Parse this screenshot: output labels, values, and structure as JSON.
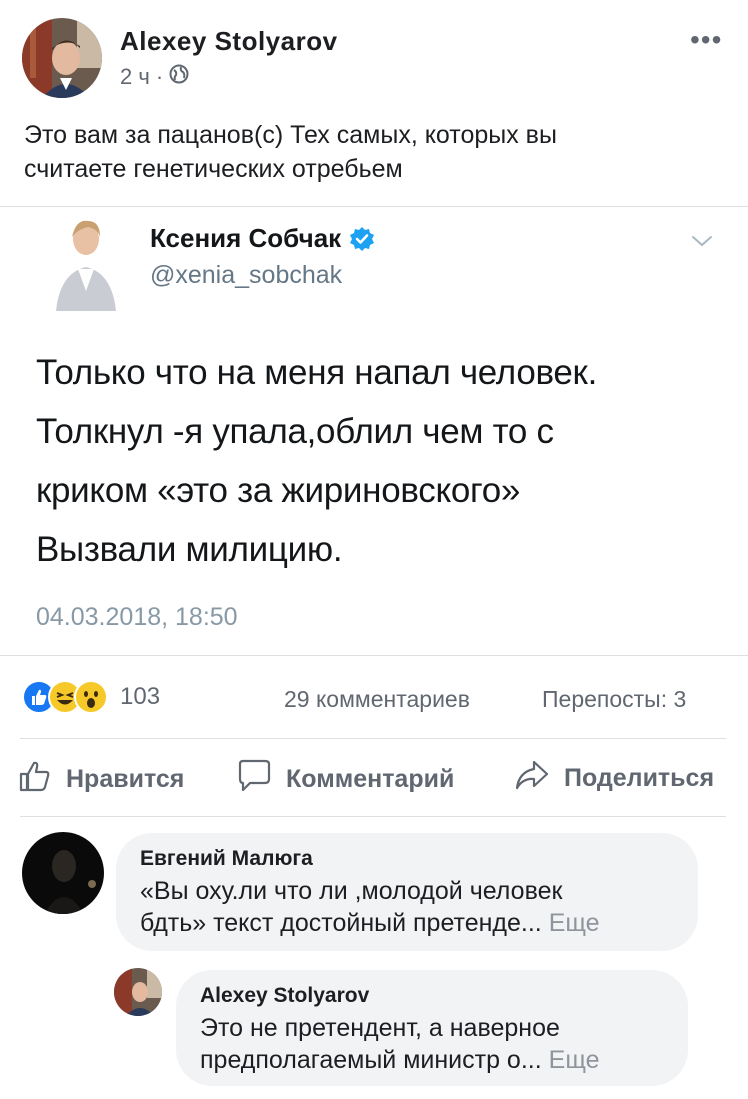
{
  "post": {
    "author": "Alexey  Stolyarov",
    "time": "2 ч",
    "separator": "·",
    "icons": {
      "globe": "globe-icon",
      "more": "more-icon"
    },
    "text_line1": "Это вам за пацанов(с) Тех самых, которых вы",
    "text_line2": "считаете генетических отребьем",
    "more": "•••"
  },
  "tweet": {
    "name": "Ксения Собчак",
    "handle": "@xenia_sobchak",
    "line1": "Только что на меня напал человек.",
    "line2": "Толкнул -я упала,облил чем то с",
    "line3": "криком «это за жириновского»",
    "line4": "Вызвали милицию.",
    "date": "04.03.2018, 18:50",
    "accent": "#1da1f2"
  },
  "stats": {
    "reactions_count": "103",
    "comments": "29 комментариев",
    "shares": "Перепосты: 3",
    "reaction_types": [
      "like",
      "haha",
      "wow"
    ]
  },
  "actions": {
    "like": "Нравится",
    "comment": "Комментарий",
    "share": "Поделиться"
  },
  "comments": [
    {
      "author": "Евгений Малюга",
      "line1": "«Вы оху.ли что ли ,молодой человек",
      "line2": "бдть» текст достойный претенде...",
      "more": "Еще"
    },
    {
      "author": "Alexey  Stolyarov",
      "line1": "Это не претендент, а наверное",
      "line2": "предполагаемый министр о...",
      "more": "Еще"
    }
  ],
  "colors": {
    "secondary_text": "#606770",
    "like_blue": "#1877f2",
    "emoji_yellow": "#f7c928"
  }
}
